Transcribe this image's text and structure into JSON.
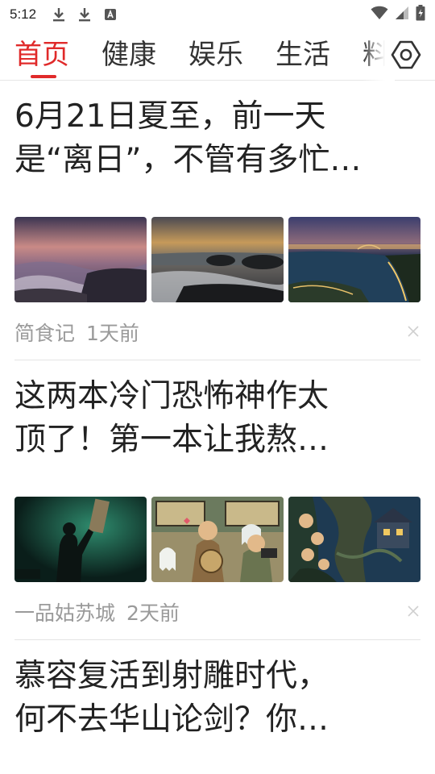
{
  "status_bar": {
    "time": "5:12",
    "icons": [
      "download-icon",
      "download-icon",
      "font-icon",
      "wifi-icon",
      "signal-icon",
      "battery-icon"
    ]
  },
  "tabs": [
    {
      "label": "首页",
      "active": true
    },
    {
      "label": "健康",
      "active": false
    },
    {
      "label": "娱乐",
      "active": false
    },
    {
      "label": "生活",
      "active": false
    },
    {
      "label": "料",
      "active": false
    }
  ],
  "colors": {
    "accent": "#e02a2a",
    "meta": "#9a9a9a"
  },
  "articles": [
    {
      "title_line1": "6月21日夏至，前一天",
      "title_line2": "是“离日”，不管有多忙…",
      "source": "简食记",
      "time": "1天前",
      "images": [
        "sea-sunset-rocks",
        "beach-rocks-dusk",
        "city-lake-night"
      ]
    },
    {
      "title_line1": "这两本冷门恐怖神作太",
      "title_line2": "顶了！第一本让我熬…",
      "source": "一品姑苏城",
      "time": "2天前",
      "images": [
        "dark-green-figure",
        "cartoon-ghosts-bus",
        "cartoon-kids-forest"
      ]
    },
    {
      "title_line1": "慕容复活到射雕时代，",
      "title_line2": "何不去华山论剑？你…"
    }
  ]
}
